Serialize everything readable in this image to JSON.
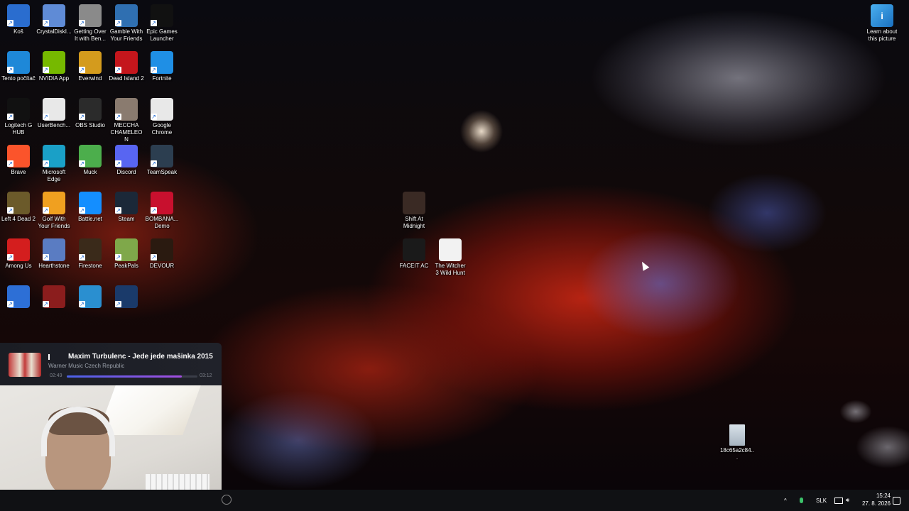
{
  "desktop_icons": [
    {
      "label": "Koš",
      "icon": "recycle-bin-icon",
      "color": "#2a6dcf"
    },
    {
      "label": "CrystalDiskI...",
      "icon": "crystaldisk-icon",
      "color": "#5f8bd6"
    },
    {
      "label": "Getting Over\nIt with Ben...",
      "icon": "hammer-icon",
      "color": "#8a8a8a"
    },
    {
      "label": "Gamble With\nYour Friends",
      "icon": "gamepad-icon",
      "color": "#2f6fb1"
    },
    {
      "label": "Epic Games\nLauncher",
      "icon": "epic-games-icon",
      "color": "#111111"
    },
    {
      "label": "Tento počítač",
      "icon": "computer-icon",
      "color": "#1e88d8"
    },
    {
      "label": "NVIDIA App",
      "icon": "nvidia-icon",
      "color": "#76b900"
    },
    {
      "label": "Everwind",
      "icon": "everwind-icon",
      "color": "#d49b1d"
    },
    {
      "label": "Dead Island 2",
      "icon": "dead-island-icon",
      "color": "#c4161c"
    },
    {
      "label": "Fortnite",
      "icon": "fortnite-icon",
      "color": "#1f8fe5"
    },
    {
      "label": "Logitech G\nHUB",
      "icon": "logitech-icon",
      "color": "#111111"
    },
    {
      "label": "UserBench...",
      "icon": "userbenchmark-icon",
      "color": "#e8e8e8"
    },
    {
      "label": "OBS Studio",
      "icon": "obs-icon",
      "color": "#2b2b2b"
    },
    {
      "label": "MECCHA\nCHAMELEON",
      "icon": "chameleon-icon",
      "color": "#8a7b6f"
    },
    {
      "label": "Google\nChrome",
      "icon": "chrome-icon",
      "color": "#e8e8e8"
    },
    {
      "label": "Brave",
      "icon": "brave-icon",
      "color": "#fb542b"
    },
    {
      "label": "Microsoft\nEdge",
      "icon": "edge-icon",
      "color": "#1aa0c7"
    },
    {
      "label": "Muck",
      "icon": "muck-icon",
      "color": "#4cae4c"
    },
    {
      "label": "Discord",
      "icon": "discord-icon",
      "color": "#5865f2"
    },
    {
      "label": "TeamSpeak",
      "icon": "teamspeak-icon",
      "color": "#2c3e50"
    },
    {
      "label": "Left 4 Dead 2",
      "icon": "l4d2-icon",
      "color": "#6b5a2a"
    },
    {
      "label": "Golf With\nYour Friends",
      "icon": "golf-icon",
      "color": "#f0a020"
    },
    {
      "label": "Battle.net",
      "icon": "battlenet-icon",
      "color": "#148eff"
    },
    {
      "label": "Steam",
      "icon": "steam-icon",
      "color": "#1b2838"
    },
    {
      "label": "BOMBANA...\nDemo",
      "icon": "bombana-icon",
      "color": "#c8102e"
    },
    {
      "label": "Among Us",
      "icon": "among-us-icon",
      "color": "#d41e1e"
    },
    {
      "label": "Hearthstone",
      "icon": "hearthstone-icon",
      "color": "#5a7cc2"
    },
    {
      "label": "Firestone",
      "icon": "firestone-icon",
      "color": "#3a2a1a"
    },
    {
      "label": "PeakPals",
      "icon": "peakpals-icon",
      "color": "#7fa84a"
    },
    {
      "label": "DEVOUR",
      "icon": "devour-icon",
      "color": "#2a1a10"
    },
    {
      "label": "",
      "icon": "app-icon",
      "color": "#2d6fd6"
    },
    {
      "label": "",
      "icon": "app-icon",
      "color": "#8b1d1d"
    },
    {
      "label": "",
      "icon": "app-icon",
      "color": "#2a8fd0"
    },
    {
      "label": "",
      "icon": "app-icon",
      "color": "#1a3a6a"
    }
  ],
  "center_icons": [
    {
      "label": "Shift At\nMidnight",
      "icon": "shift-at-midnight-icon",
      "color": "#3a2a24"
    },
    {
      "label": "FACEIT AC",
      "icon": "faceit-icon",
      "color": "#1a1a1a"
    },
    {
      "label": "The Witcher\n3 Wild Hunt",
      "icon": "witcher-icon",
      "color": "#f2f2f2"
    }
  ],
  "corner_icon": {
    "label": "Learn about\nthis picture",
    "icon": "info-picture-icon",
    "color": "#2a8fd6"
  },
  "file_icon": {
    "label": "18c65a2c84...",
    "icon": "image-file-icon",
    "color": "#bfc8d0"
  },
  "now_playing": {
    "title": "Maxim Turbulenc - Jede jede mašinka 2015",
    "artist": "Warner Music Czech Republic",
    "elapsed": "02:49",
    "duration": "03:12",
    "progress": 0.88
  },
  "taskbar": {
    "language": "SLK",
    "time": "15:24",
    "date": "27. 8. 2026"
  }
}
